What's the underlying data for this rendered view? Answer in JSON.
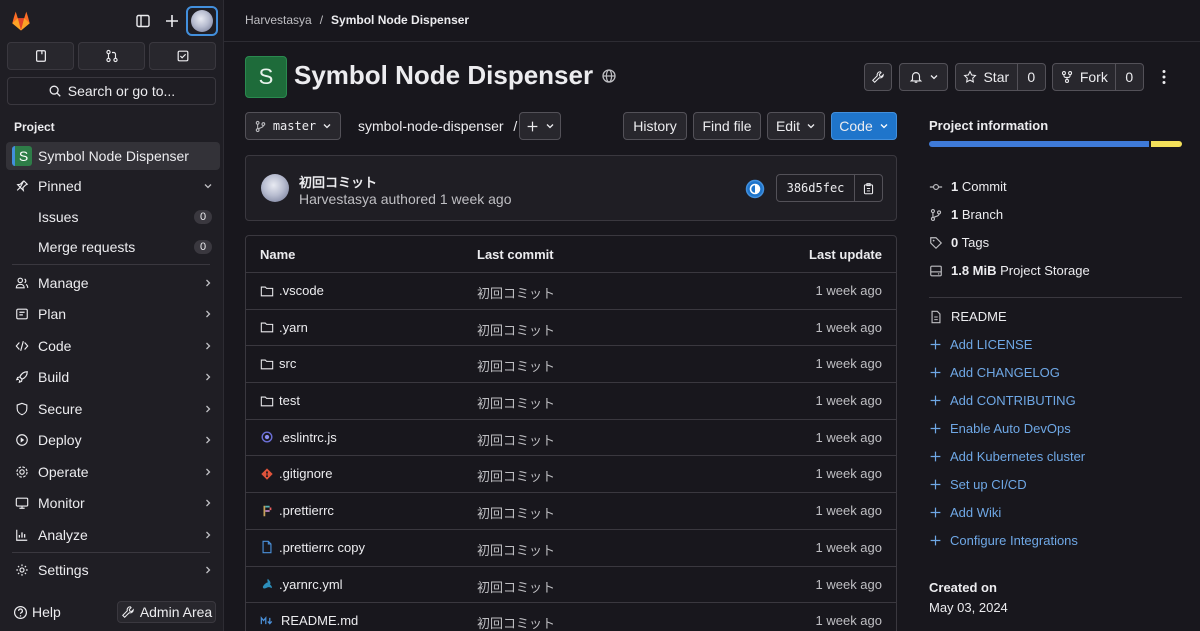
{
  "sidebar": {
    "section_label": "Project",
    "search_label": "Search or go to...",
    "project_initial": "S",
    "project_name": "Symbol Node Dispenser",
    "pinned_label": "Pinned",
    "issues_label": "Issues",
    "issues_count": "0",
    "mr_label": "Merge requests",
    "mr_count": "0",
    "nav": [
      "Manage",
      "Plan",
      "Code",
      "Build",
      "Secure",
      "Deploy",
      "Operate",
      "Monitor",
      "Analyze"
    ],
    "settings_label": "Settings",
    "help_label": "Help",
    "admin_label": "Admin Area"
  },
  "breadcrumb": {
    "group": "Harvestasya",
    "separator": "/",
    "current": "Symbol Node Dispenser"
  },
  "header": {
    "avatar_initial": "S",
    "title": "Symbol Node Dispenser",
    "star_label": "Star",
    "star_count": "0",
    "fork_label": "Fork",
    "fork_count": "0"
  },
  "toolbar": {
    "branch": "master",
    "path": "symbol-node-dispenser",
    "path_sep": "/",
    "history": "History",
    "find_file": "Find file",
    "edit": "Edit",
    "code": "Code"
  },
  "commit": {
    "title": "初回コミット",
    "author": "Harvestasya",
    "action": "authored",
    "time": "1 week ago",
    "sha": "386d5fec"
  },
  "files": {
    "headers": {
      "name": "Name",
      "last_commit": "Last commit",
      "last_update": "Last update"
    },
    "rows": [
      {
        "name": ".vscode",
        "icon": "folder-icon",
        "commit": "初回コミット",
        "updated": "1 week ago"
      },
      {
        "name": ".yarn",
        "icon": "folder-icon",
        "commit": "初回コミット",
        "updated": "1 week ago"
      },
      {
        "name": "src",
        "icon": "folder-icon",
        "commit": "初回コミット",
        "updated": "1 week ago"
      },
      {
        "name": "test",
        "icon": "folder-icon",
        "commit": "初回コミット",
        "updated": "1 week ago"
      },
      {
        "name": ".eslintrc.js",
        "icon": "eslint-icon",
        "commit": "初回コミット",
        "updated": "1 week ago"
      },
      {
        "name": ".gitignore",
        "icon": "git-icon",
        "commit": "初回コミット",
        "updated": "1 week ago"
      },
      {
        "name": ".prettierrc",
        "icon": "prettier-icon",
        "commit": "初回コミット",
        "updated": "1 week ago"
      },
      {
        "name": ".prettierrc copy",
        "icon": "file-icon",
        "commit": "初回コミット",
        "updated": "1 week ago"
      },
      {
        "name": ".yarnrc.yml",
        "icon": "yarn-icon",
        "commit": "初回コミット",
        "updated": "1 week ago"
      },
      {
        "name": "README.md",
        "icon": "markdown-icon",
        "commit": "初回コミット",
        "updated": "1 week ago"
      }
    ]
  },
  "project_info": {
    "title": "Project information",
    "language_bar": {
      "blue": 0.87,
      "yellow": 0.13
    },
    "stats": [
      {
        "value": "1",
        "label": "Commit",
        "icon": "commit-icon"
      },
      {
        "value": "1",
        "label": "Branch",
        "icon": "branch-icon"
      },
      {
        "value": "0",
        "label": "Tags",
        "icon": "tag-icon"
      },
      {
        "value": "1.8 MiB",
        "label": "Project Storage",
        "icon": "storage-icon"
      }
    ],
    "readme": "README",
    "links": [
      "Add LICENSE",
      "Add CHANGELOG",
      "Add CONTRIBUTING",
      "Enable Auto DevOps",
      "Add Kubernetes cluster",
      "Set up CI/CD",
      "Add Wiki",
      "Configure Integrations"
    ],
    "created_label": "Created on",
    "created_value": "May 03, 2024"
  },
  "colors": {
    "accent": "#1f75cb",
    "link": "#6fa8e6",
    "bg": "#18171d",
    "sidebar": "#1f1e24",
    "lang_blue": "#3e7ad8",
    "lang_yellow": "#f3e05a"
  }
}
